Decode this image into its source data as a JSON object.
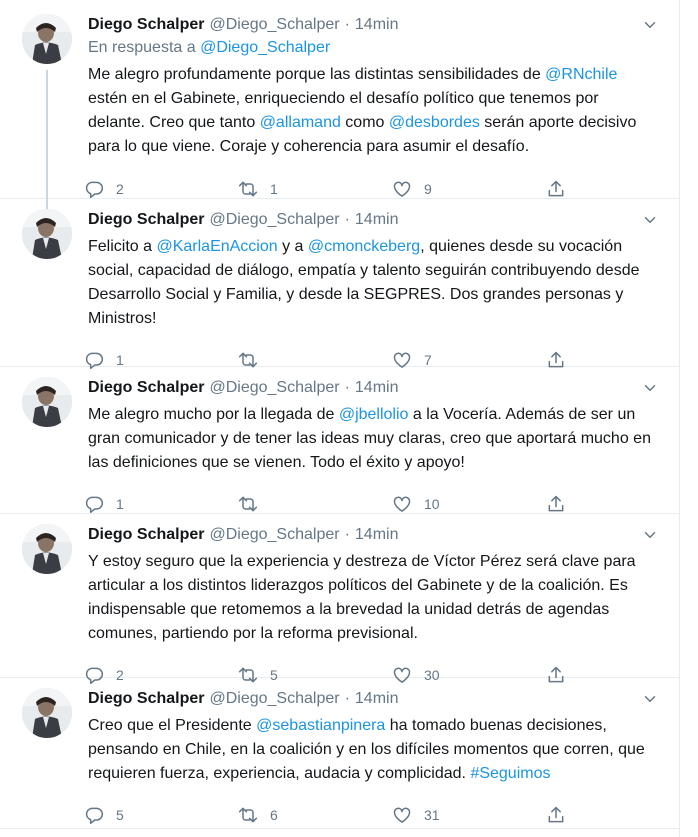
{
  "tweets": [
    {
      "name": "Diego Schalper",
      "handle": "@Diego_Schalper",
      "dot": "·",
      "time": "14min",
      "reply_prefix": "En respuesta a ",
      "reply_to": "@Diego_Schalper",
      "segments": [
        {
          "t": "Me alegro profundamente porque las distintas sensibilidades de "
        },
        {
          "t": "@RNchile",
          "link": true
        },
        {
          "t": " estén en el Gabinete, enriqueciendo el desafío político que tenemos por delante. Creo que tanto "
        },
        {
          "t": "@allamand",
          "link": true
        },
        {
          "t": " como "
        },
        {
          "t": "@desbordes",
          "link": true
        },
        {
          "t": " serán aporte decisivo para lo que viene. Coraje y coherencia para asumir el desafío."
        }
      ],
      "replies": "2",
      "retweets": "1",
      "likes": "9"
    },
    {
      "name": "Diego Schalper",
      "handle": "@Diego_Schalper",
      "dot": "·",
      "time": "14min",
      "segments": [
        {
          "t": "Felicito a "
        },
        {
          "t": "@KarlaEnAccion",
          "link": true
        },
        {
          "t": " y a "
        },
        {
          "t": "@cmonckeberg",
          "link": true
        },
        {
          "t": ", quienes desde su vocación social, capacidad de diálogo, empatía y talento seguirán contribuyendo desde Desarrollo Social y Familia, y desde la SEGPRES. Dos grandes personas y Ministros!"
        }
      ],
      "replies": "1",
      "retweets": "",
      "likes": "7"
    },
    {
      "name": "Diego Schalper",
      "handle": "@Diego_Schalper",
      "dot": "·",
      "time": "14min",
      "segments": [
        {
          "t": "Me alegro mucho por la llegada de "
        },
        {
          "t": "@jbellolio",
          "link": true
        },
        {
          "t": " a la Vocería. Además de ser un gran comunicador y de tener las ideas muy claras, creo que aportará mucho en las definiciones que se vienen. Todo el éxito y apoyo!"
        }
      ],
      "replies": "1",
      "retweets": "",
      "likes": "10"
    },
    {
      "name": "Diego Schalper",
      "handle": "@Diego_Schalper",
      "dot": "·",
      "time": "14min",
      "segments": [
        {
          "t": "Y estoy seguro que la experiencia y destreza de Víctor Pérez será clave para articular a los distintos liderazgos políticos del Gabinete y de la coalición. Es indispensable que retomemos a la brevedad la unidad detrás de agendas comunes, partiendo por la reforma previsional."
        }
      ],
      "replies": "2",
      "retweets": "5",
      "likes": "30"
    },
    {
      "name": "Diego Schalper",
      "handle": "@Diego_Schalper",
      "dot": "·",
      "time": "14min",
      "segments": [
        {
          "t": "Creo que el Presidente "
        },
        {
          "t": "@sebastianpinera",
          "link": true
        },
        {
          "t": " ha tomado buenas decisiones, pensando en Chile, en la coalición y en los difíciles momentos que corren, que requieren fuerza, experiencia, audacia y complicidad. "
        },
        {
          "t": "#Seguimos",
          "link": true
        }
      ],
      "replies": "5",
      "retweets": "6",
      "likes": "31"
    }
  ],
  "icons": {
    "reply": "reply-icon",
    "retweet": "retweet-icon",
    "like": "heart-icon",
    "share": "share-icon",
    "caret": "chevron-down-icon"
  },
  "colors": {
    "link": "#1b95e0",
    "muted": "#657786",
    "text": "#14171a",
    "divider": "#e6ecf0"
  }
}
